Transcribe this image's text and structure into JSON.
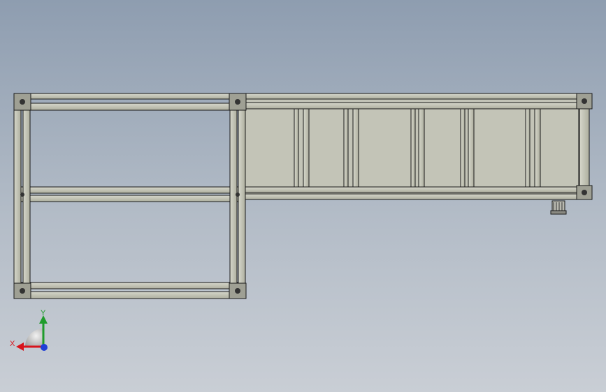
{
  "viewport": {
    "background_top": "#8e9db0",
    "background_bottom": "#c9ced5"
  },
  "model": {
    "frame_color": "#c4c5b8",
    "frame_edge_color": "#1a1a1a",
    "panel_color": "#c2c3b6"
  },
  "triad": {
    "x_label": "X",
    "y_label": "Y",
    "x_color": "#d8141c",
    "y_color": "#1f9c2c",
    "z_color": "#1f3fd6"
  }
}
